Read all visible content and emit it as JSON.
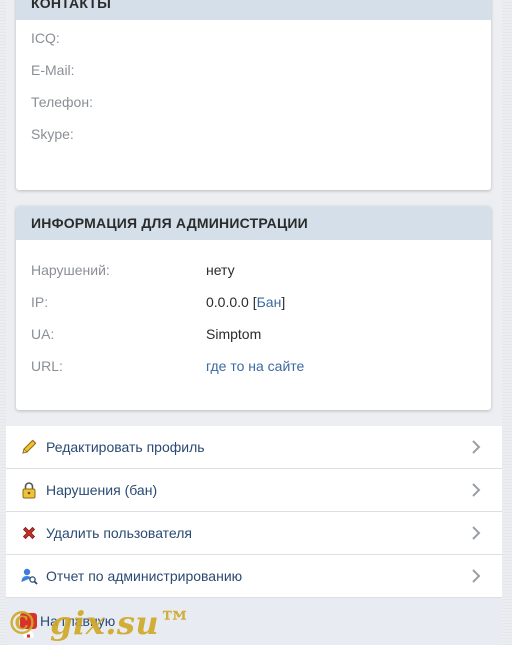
{
  "contacts": {
    "title": "КОНТАКТЫ",
    "rows": [
      {
        "label": "ICQ:",
        "value": ""
      },
      {
        "label": "E-Mail:",
        "value": ""
      },
      {
        "label": "Телефон:",
        "value": ""
      },
      {
        "label": "Skype:",
        "value": ""
      }
    ]
  },
  "admin_info": {
    "title": "ИНФОРМАЦИЯ ДЛЯ АДМИНИСТРАЦИИ",
    "violations_label": "Нарушений:",
    "violations_value": "нету",
    "ip_label": "IP:",
    "ip_value": "0.0.0.0",
    "ip_ban_open": "[",
    "ip_ban_link": "Бан",
    "ip_ban_close": "]",
    "ua_label": "UA:",
    "ua_value": "Simptom",
    "url_label": "URL:",
    "url_value": "где то на сайте"
  },
  "menu": {
    "items": [
      {
        "label": "Редактировать профиль",
        "icon": "pencil-icon"
      },
      {
        "label": "Нарушения (бан)",
        "icon": "padlock-icon"
      },
      {
        "label": "Удалить пользователя",
        "icon": "red-x-icon"
      },
      {
        "label": "Отчет по администрированию",
        "icon": "user-search-icon"
      }
    ],
    "home_label": "На главную"
  },
  "watermark": "© gix.su™",
  "colors": {
    "card_header_bg": "#d5dfe9",
    "link": "#3b6aa0",
    "menu_text": "#2a4a72",
    "label_gray": "#8a8f96",
    "watermark_gold": "#cfa928"
  }
}
